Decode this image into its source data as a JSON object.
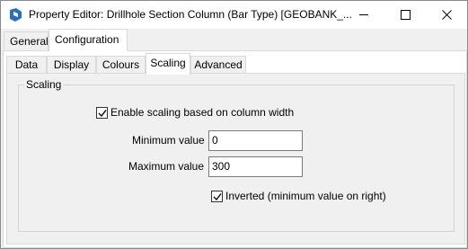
{
  "window": {
    "title": "Property Editor: Drillhole Section Column (Bar Type) [GEOBANK_..."
  },
  "tabs_top": [
    {
      "label": "General"
    },
    {
      "label": "Configuration"
    }
  ],
  "tabs_sub": [
    {
      "label": "Data"
    },
    {
      "label": "Display"
    },
    {
      "label": "Colours"
    },
    {
      "label": "Scaling"
    },
    {
      "label": "Advanced"
    }
  ],
  "scaling": {
    "group_title": "Scaling",
    "enable_label": "Enable scaling based on column width",
    "enable_checked": true,
    "min_label": "Minimum value",
    "min_value": "0",
    "max_label": "Maximum value",
    "max_value": "300",
    "inverted_label": "Inverted (minimum value on right)",
    "inverted_checked": true
  },
  "colors": {
    "icon_blue": "#2a6fb8",
    "panel_bg": "#f0f0f0"
  }
}
